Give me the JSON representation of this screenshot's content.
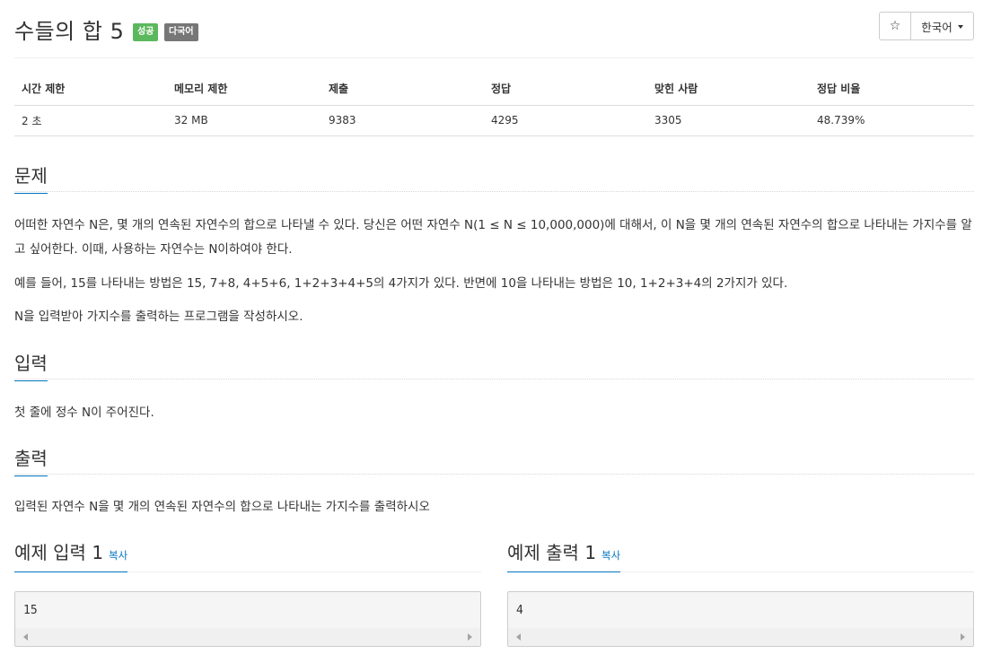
{
  "problem": {
    "title": "수들의 합 5",
    "badges": {
      "success": "성공",
      "multilang": "다국어"
    }
  },
  "toolbar": {
    "star_icon": "☆",
    "language_label": "한국어"
  },
  "info_table": {
    "headers": [
      "시간 제한",
      "메모리 제한",
      "제출",
      "정답",
      "맞힌 사람",
      "정답 비율"
    ],
    "values": [
      "2 초",
      "32 MB",
      "9383",
      "4295",
      "3305",
      "48.739%"
    ]
  },
  "sections": {
    "problem": {
      "heading": "문제",
      "paragraphs": [
        "어떠한 자연수 N은, 몇 개의 연속된 자연수의 합으로 나타낼 수 있다. 당신은 어떤 자연수 N(1 ≤ N ≤ 10,000,000)에 대해서, 이 N을 몇 개의 연속된 자연수의 합으로 나타내는 가지수를 알고 싶어한다. 이때, 사용하는 자연수는 N이하여야 한다.",
        "예를 들어, 15를 나타내는 방법은 15, 7+8, 4+5+6, 1+2+3+4+5의 4가지가 있다. 반면에 10을 나타내는 방법은 10, 1+2+3+4의 2가지가 있다.",
        "N을 입력받아 가지수를 출력하는 프로그램을 작성하시오."
      ]
    },
    "input": {
      "heading": "입력",
      "text": "첫 줄에 정수 N이 주어진다."
    },
    "output": {
      "heading": "출력",
      "text": "입력된 자연수 N을 몇 개의 연속된 자연수의 합으로 나타내는 가지수를 출력하시오"
    }
  },
  "samples": {
    "input": {
      "heading": "예제 입력 1",
      "copy_label": "복사",
      "content": "15"
    },
    "output": {
      "heading": "예제 출력 1",
      "copy_label": "복사",
      "content": "4"
    }
  }
}
